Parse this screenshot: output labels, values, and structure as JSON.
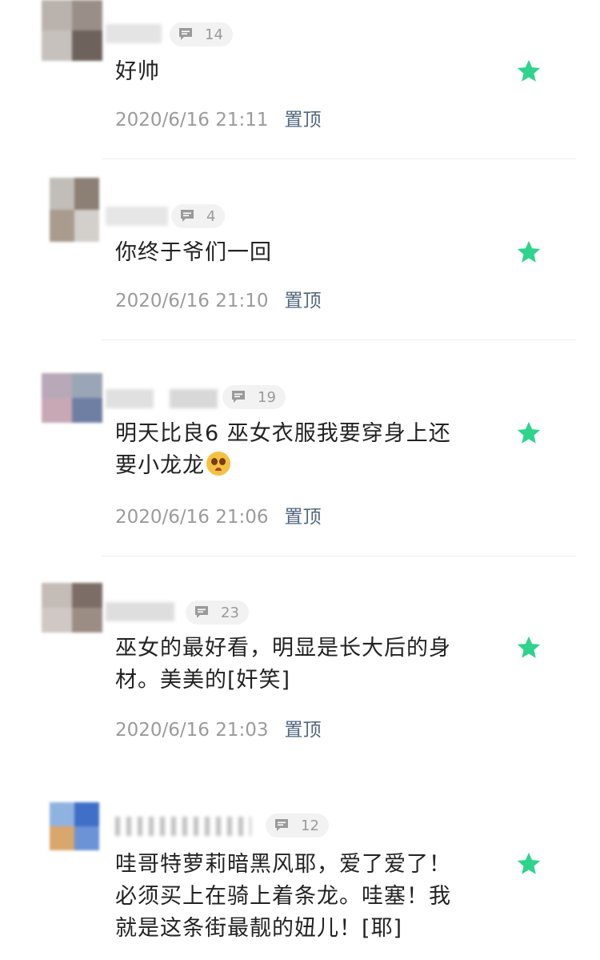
{
  "colors": {
    "accent_star": "#2ed48c",
    "pin_link": "#51667f",
    "meta": "#9b9b9b"
  },
  "comments": [
    {
      "reply_count": "14",
      "text_lines": [
        "好帅"
      ],
      "time": "2020/6/16 21:11",
      "pin_label": "置顶"
    },
    {
      "reply_count": "4",
      "text_lines": [
        "你终于爷们一回"
      ],
      "time": "2020/6/16 21:10",
      "pin_label": "置顶"
    },
    {
      "reply_count": "19",
      "text_lines": [
        "明天比良6 巫女衣服我要穿身上还",
        "要小龙龙"
      ],
      "emoji": "pleading-face-emoji",
      "time": "2020/6/16 21:06",
      "pin_label": "置顶"
    },
    {
      "reply_count": "23",
      "text_lines": [
        "巫女的最好看，明显是长大后的身",
        "材。美美的[奸笑]"
      ],
      "time": "2020/6/16 21:03",
      "pin_label": "置顶"
    },
    {
      "reply_count": "12",
      "text_lines": [
        "哇哥特萝莉暗黑风耶，爱了爱了！",
        "必须买上在骑上着条龙。哇塞！我",
        "就是这条街最靓的妞儿！[耶]"
      ]
    }
  ],
  "icons": {
    "reply": "comment-bubble-icon",
    "star": "star-icon"
  }
}
